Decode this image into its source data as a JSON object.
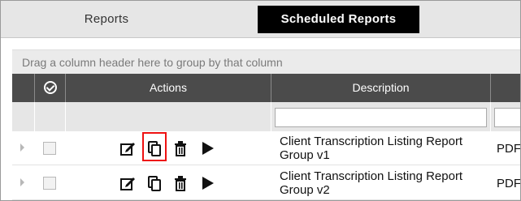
{
  "tabs": {
    "reports": "Reports",
    "scheduled_reports": "Scheduled Reports"
  },
  "grid": {
    "group_panel_text": "Drag a column header here to group by that column",
    "columns": {
      "actions": "Actions",
      "description": "Description"
    },
    "filter": {
      "description_value": "",
      "next_value": ""
    },
    "rows": [
      {
        "description": "Client Transcription Listing Report Group v1",
        "format": "PDF",
        "copy_highlighted": true
      },
      {
        "description": "Client Transcription Listing Report Group v2",
        "format": "PDF",
        "copy_highlighted": false
      }
    ]
  },
  "colors": {
    "active_tab_bg": "#000000",
    "header_bg": "#4b4b4b",
    "highlight": "#ee1111"
  },
  "icons": [
    "edit-icon",
    "copy-icon",
    "delete-icon",
    "run-icon",
    "check-circle-icon",
    "expand-arrow-icon"
  ]
}
